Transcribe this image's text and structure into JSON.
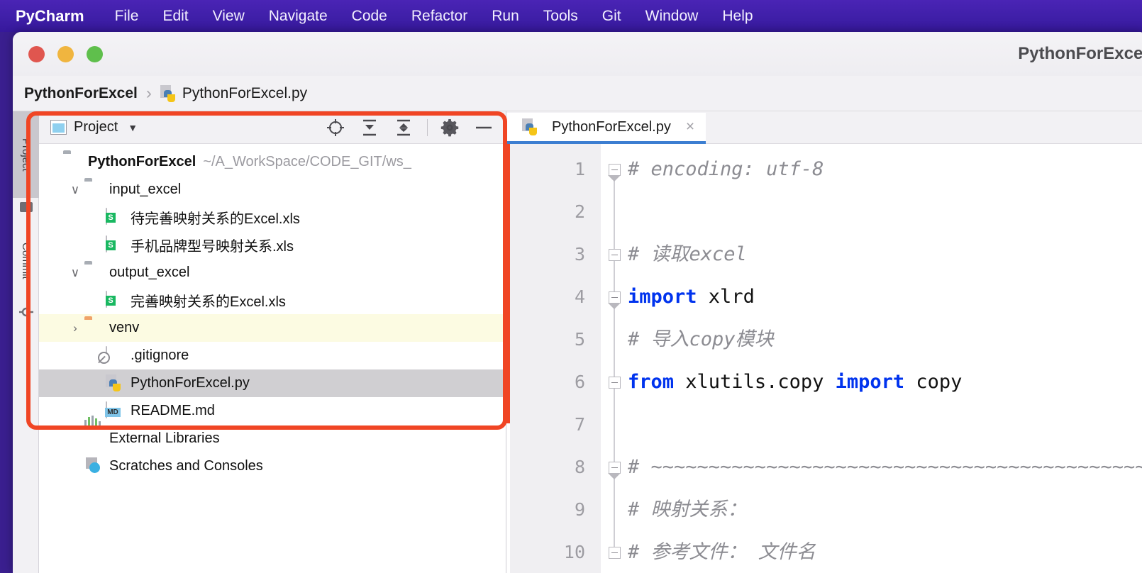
{
  "menubar": {
    "app": "PyCharm",
    "items": [
      "File",
      "Edit",
      "View",
      "Navigate",
      "Code",
      "Refactor",
      "Run",
      "Tools",
      "Git",
      "Window",
      "Help"
    ]
  },
  "window": {
    "title": "PythonForExcel",
    "traffic_lights": [
      "close-button",
      "minimize-button",
      "zoom-button"
    ]
  },
  "breadcrumb": {
    "root": "PythonForExcel",
    "separator": "›",
    "file": "PythonForExcel.py"
  },
  "tool_strip": {
    "tabs": [
      {
        "label": "Project",
        "active": true
      },
      {
        "label": "Commit",
        "active": false
      }
    ]
  },
  "project_panel": {
    "title": "Project",
    "dropdown_caret": "▼",
    "buttons": [
      {
        "name": "select-opened-file-button",
        "icon": "crosshair-icon"
      },
      {
        "name": "expand-all-button",
        "icon": "expand-all-icon"
      },
      {
        "name": "collapse-all-button",
        "icon": "collapse-all-icon"
      },
      {
        "name": "settings-button",
        "icon": "gear-icon"
      },
      {
        "name": "hide-button",
        "icon": "minus-icon"
      }
    ],
    "tree": [
      {
        "label": "PythonForExcel",
        "path": "~/A_WorkSpace/CODE_GIT/ws_",
        "icon": "folder-icon",
        "indent": 0,
        "arrow": "",
        "bold": true,
        "state": "normal"
      },
      {
        "label": "input_excel",
        "path": "",
        "icon": "folder-icon",
        "indent": 1,
        "arrow": "∨",
        "bold": false,
        "state": "normal"
      },
      {
        "label": "待完善映射关系的Excel.xls",
        "path": "",
        "icon": "xls-icon",
        "indent": 2,
        "arrow": "",
        "bold": false,
        "state": "normal"
      },
      {
        "label": "手机品牌型号映射关系.xls",
        "path": "",
        "icon": "xls-icon",
        "indent": 2,
        "arrow": "",
        "bold": false,
        "state": "normal"
      },
      {
        "label": "output_excel",
        "path": "",
        "icon": "folder-icon",
        "indent": 1,
        "arrow": "∨",
        "bold": false,
        "state": "normal"
      },
      {
        "label": "完善映射关系的Excel.xls",
        "path": "",
        "icon": "xls-icon",
        "indent": 2,
        "arrow": "",
        "bold": false,
        "state": "normal"
      },
      {
        "label": "venv",
        "path": "",
        "icon": "folder-orange-icon",
        "indent": 1,
        "arrow": "›",
        "bold": false,
        "state": "highlighted"
      },
      {
        "label": ".gitignore",
        "path": "",
        "icon": "gitignore-icon",
        "indent": 2,
        "arrow": "",
        "bold": false,
        "state": "normal"
      },
      {
        "label": "PythonForExcel.py",
        "path": "",
        "icon": "python-file-icon",
        "indent": 2,
        "arrow": "",
        "bold": false,
        "state": "selected"
      },
      {
        "label": "README.md",
        "path": "",
        "icon": "markdown-icon",
        "indent": 2,
        "arrow": "",
        "bold": false,
        "state": "normal"
      },
      {
        "label": "External Libraries",
        "path": "",
        "icon": "external-libraries-icon",
        "indent": 1,
        "arrow": "",
        "bold": false,
        "state": "normal"
      },
      {
        "label": "Scratches and Consoles",
        "path": "",
        "icon": "scratches-icon",
        "indent": 1,
        "arrow": "",
        "bold": false,
        "state": "normal"
      }
    ]
  },
  "editor": {
    "tab": {
      "label": "PythonForExcel.py",
      "close_glyph": "×",
      "icon": "python-file-icon"
    },
    "line_numbers": [
      "1",
      "2",
      "3",
      "4",
      "5",
      "6",
      "7",
      "8",
      "9",
      "10"
    ],
    "lines": [
      {
        "n": "1",
        "fold": "down",
        "segments": [
          {
            "t": "# encoding: utf-8",
            "k": "cmt"
          }
        ]
      },
      {
        "n": "2",
        "fold": "",
        "segments": []
      },
      {
        "n": "3",
        "fold": "mid",
        "segments": [
          {
            "t": "# 读取excel",
            "k": "cmt"
          }
        ]
      },
      {
        "n": "4",
        "fold": "down",
        "segments": [
          {
            "t": "import",
            "k": "kw"
          },
          {
            "t": " xlrd",
            "k": "txt"
          }
        ]
      },
      {
        "n": "5",
        "fold": "",
        "segments": [
          {
            "t": "# 导入copy模块",
            "k": "cmt"
          }
        ]
      },
      {
        "n": "6",
        "fold": "mid",
        "segments": [
          {
            "t": "from",
            "k": "kw"
          },
          {
            "t": " xlutils.copy ",
            "k": "txt"
          },
          {
            "t": "import",
            "k": "kw"
          },
          {
            "t": " copy",
            "k": "txt"
          }
        ]
      },
      {
        "n": "7",
        "fold": "",
        "segments": []
      },
      {
        "n": "8",
        "fold": "down",
        "segments": [
          {
            "t": "# ~~~~~~~~~~~~~~~~~~~~~~~~~~~~~~~~~~~~~~~~~~~",
            "k": "cmt"
          }
        ]
      },
      {
        "n": "9",
        "fold": "",
        "segments": [
          {
            "t": "# 映射关系：",
            "k": "cmt"
          }
        ]
      },
      {
        "n": "10",
        "fold": "mid",
        "segments": [
          {
            "t": "# 参考文件： 文件名",
            "k": "cmt"
          }
        ]
      }
    ]
  },
  "annotation": {
    "shape": "rectangle",
    "color": "#f04524",
    "target": "project-tree"
  },
  "colors": {
    "menubar": "#3f1fa8",
    "accent_blue": "#3c7ed1",
    "annotation_red": "#f04524",
    "selection_gray": "#d0cfd2",
    "highlight_yellow": "#fcfbe2",
    "keyword_blue": "#0033ee",
    "comment_gray": "#8c8c92"
  }
}
